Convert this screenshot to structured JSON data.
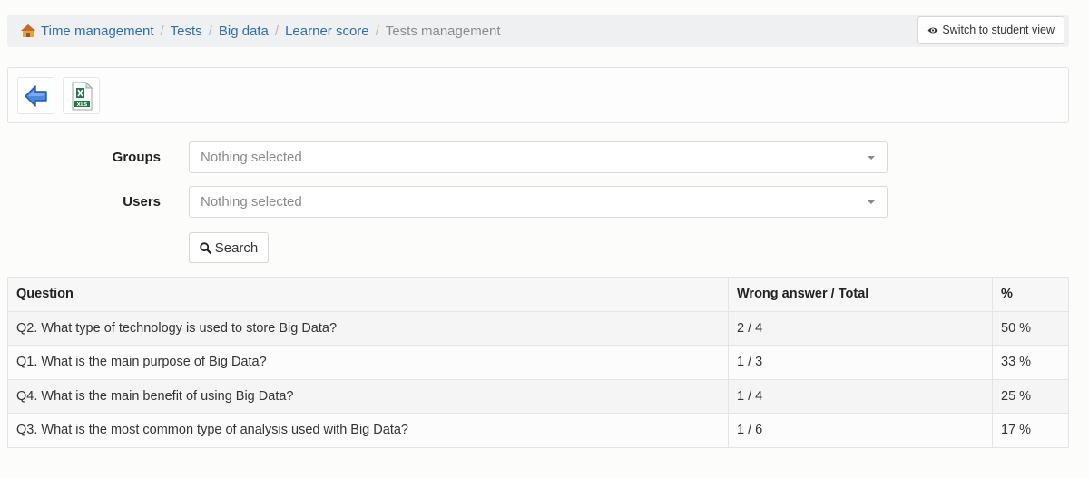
{
  "breadcrumb": {
    "items": [
      {
        "label": "Time management",
        "icon": "home-icon"
      },
      {
        "label": "Tests"
      },
      {
        "label": "Big data"
      },
      {
        "label": "Learner score"
      }
    ],
    "current": "Tests management",
    "separator": "/"
  },
  "header": {
    "switch_view_label": "Switch to student view",
    "switch_view_icon": "eye-icon"
  },
  "toolbar": {
    "back_icon": "back-arrow-icon",
    "export_icon": "xls-export-icon",
    "export_badge": "XLS"
  },
  "filters": {
    "groups": {
      "label": "Groups",
      "value": "Nothing selected"
    },
    "users": {
      "label": "Users",
      "value": "Nothing selected"
    },
    "search_label": "Search"
  },
  "table": {
    "headers": [
      "Question",
      "Wrong answer / Total",
      "%"
    ],
    "rows": [
      [
        "Q2. What type of technology is used to store Big Data?",
        "2 / 4",
        "50 %"
      ],
      [
        "Q1. What is the main purpose of Big Data?",
        "1 / 3",
        "33 %"
      ],
      [
        "Q4. What is the main benefit of using Big Data?",
        "1 / 4",
        "25 %"
      ],
      [
        "Q3. What is the most common type of analysis used with Big Data?",
        "1 / 6",
        "17 %"
      ]
    ]
  },
  "colors": {
    "link": "#2e6fa8",
    "breadcrumb_bg": "#eef0f1",
    "back_arrow": "#3d7fd6",
    "excel_green": "#1e7a43"
  }
}
